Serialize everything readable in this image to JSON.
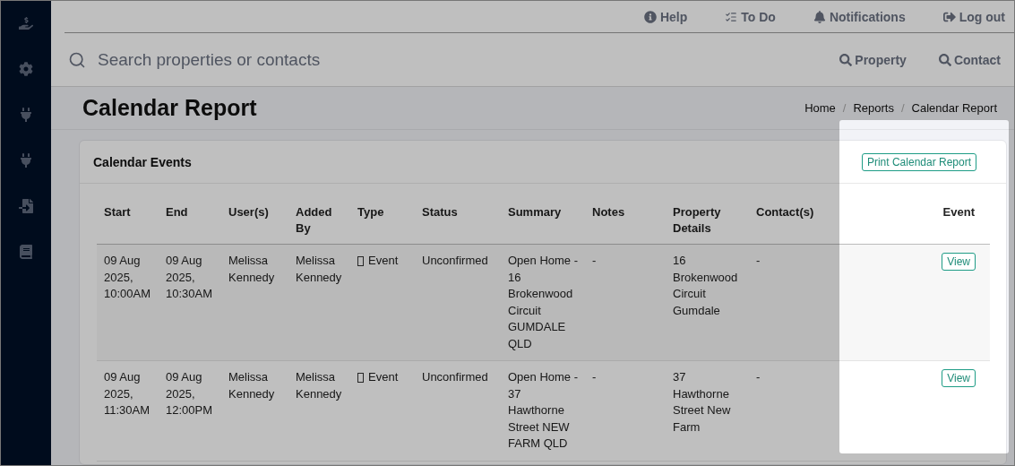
{
  "top_nav": [
    {
      "label": "Help"
    },
    {
      "label": "To Do"
    },
    {
      "label": "Notifications"
    },
    {
      "label": "Log out"
    }
  ],
  "search": {
    "placeholder": "Search properties or contacts",
    "buttons": [
      "Property",
      "Contact"
    ]
  },
  "page": {
    "title": "Calendar Report",
    "breadcrumb": [
      {
        "label": "Home"
      },
      {
        "label": "Reports"
      },
      {
        "label": "Calendar Report"
      }
    ],
    "separator": "/"
  },
  "card": {
    "title": "Calendar Events",
    "print_button": "Print Calendar Report"
  },
  "table": {
    "columns": [
      "Start",
      "End",
      "User(s)",
      "Added By",
      "Type",
      "Status",
      "Summary",
      "Notes",
      "Property Details",
      "Contact(s)",
      "Event"
    ],
    "rows": [
      {
        "start": "09 Aug 2025, 10:00AM",
        "end": "09 Aug 2025, 10:30AM",
        "users": "Melissa Kennedy",
        "added_by": "Melissa Kennedy",
        "type": "Event",
        "status": "Unconfirmed",
        "summary": "Open Home - 16 Brokenwood Circuit GUMDALE QLD",
        "notes": "-",
        "property": "16 Brokenwood Circuit Gumdale",
        "contacts": "-",
        "action": "View"
      },
      {
        "start": "09 Aug 2025, 11:30AM",
        "end": "09 Aug 2025, 12:00PM",
        "users": "Melissa Kennedy",
        "added_by": "Melissa Kennedy",
        "type": "Event",
        "status": "Unconfirmed",
        "summary": "Open Home - 37 Hawthorne Street NEW FARM QLD",
        "notes": "-",
        "property": "37 Hawthorne Street New Farm",
        "contacts": "-",
        "action": "View"
      }
    ]
  }
}
